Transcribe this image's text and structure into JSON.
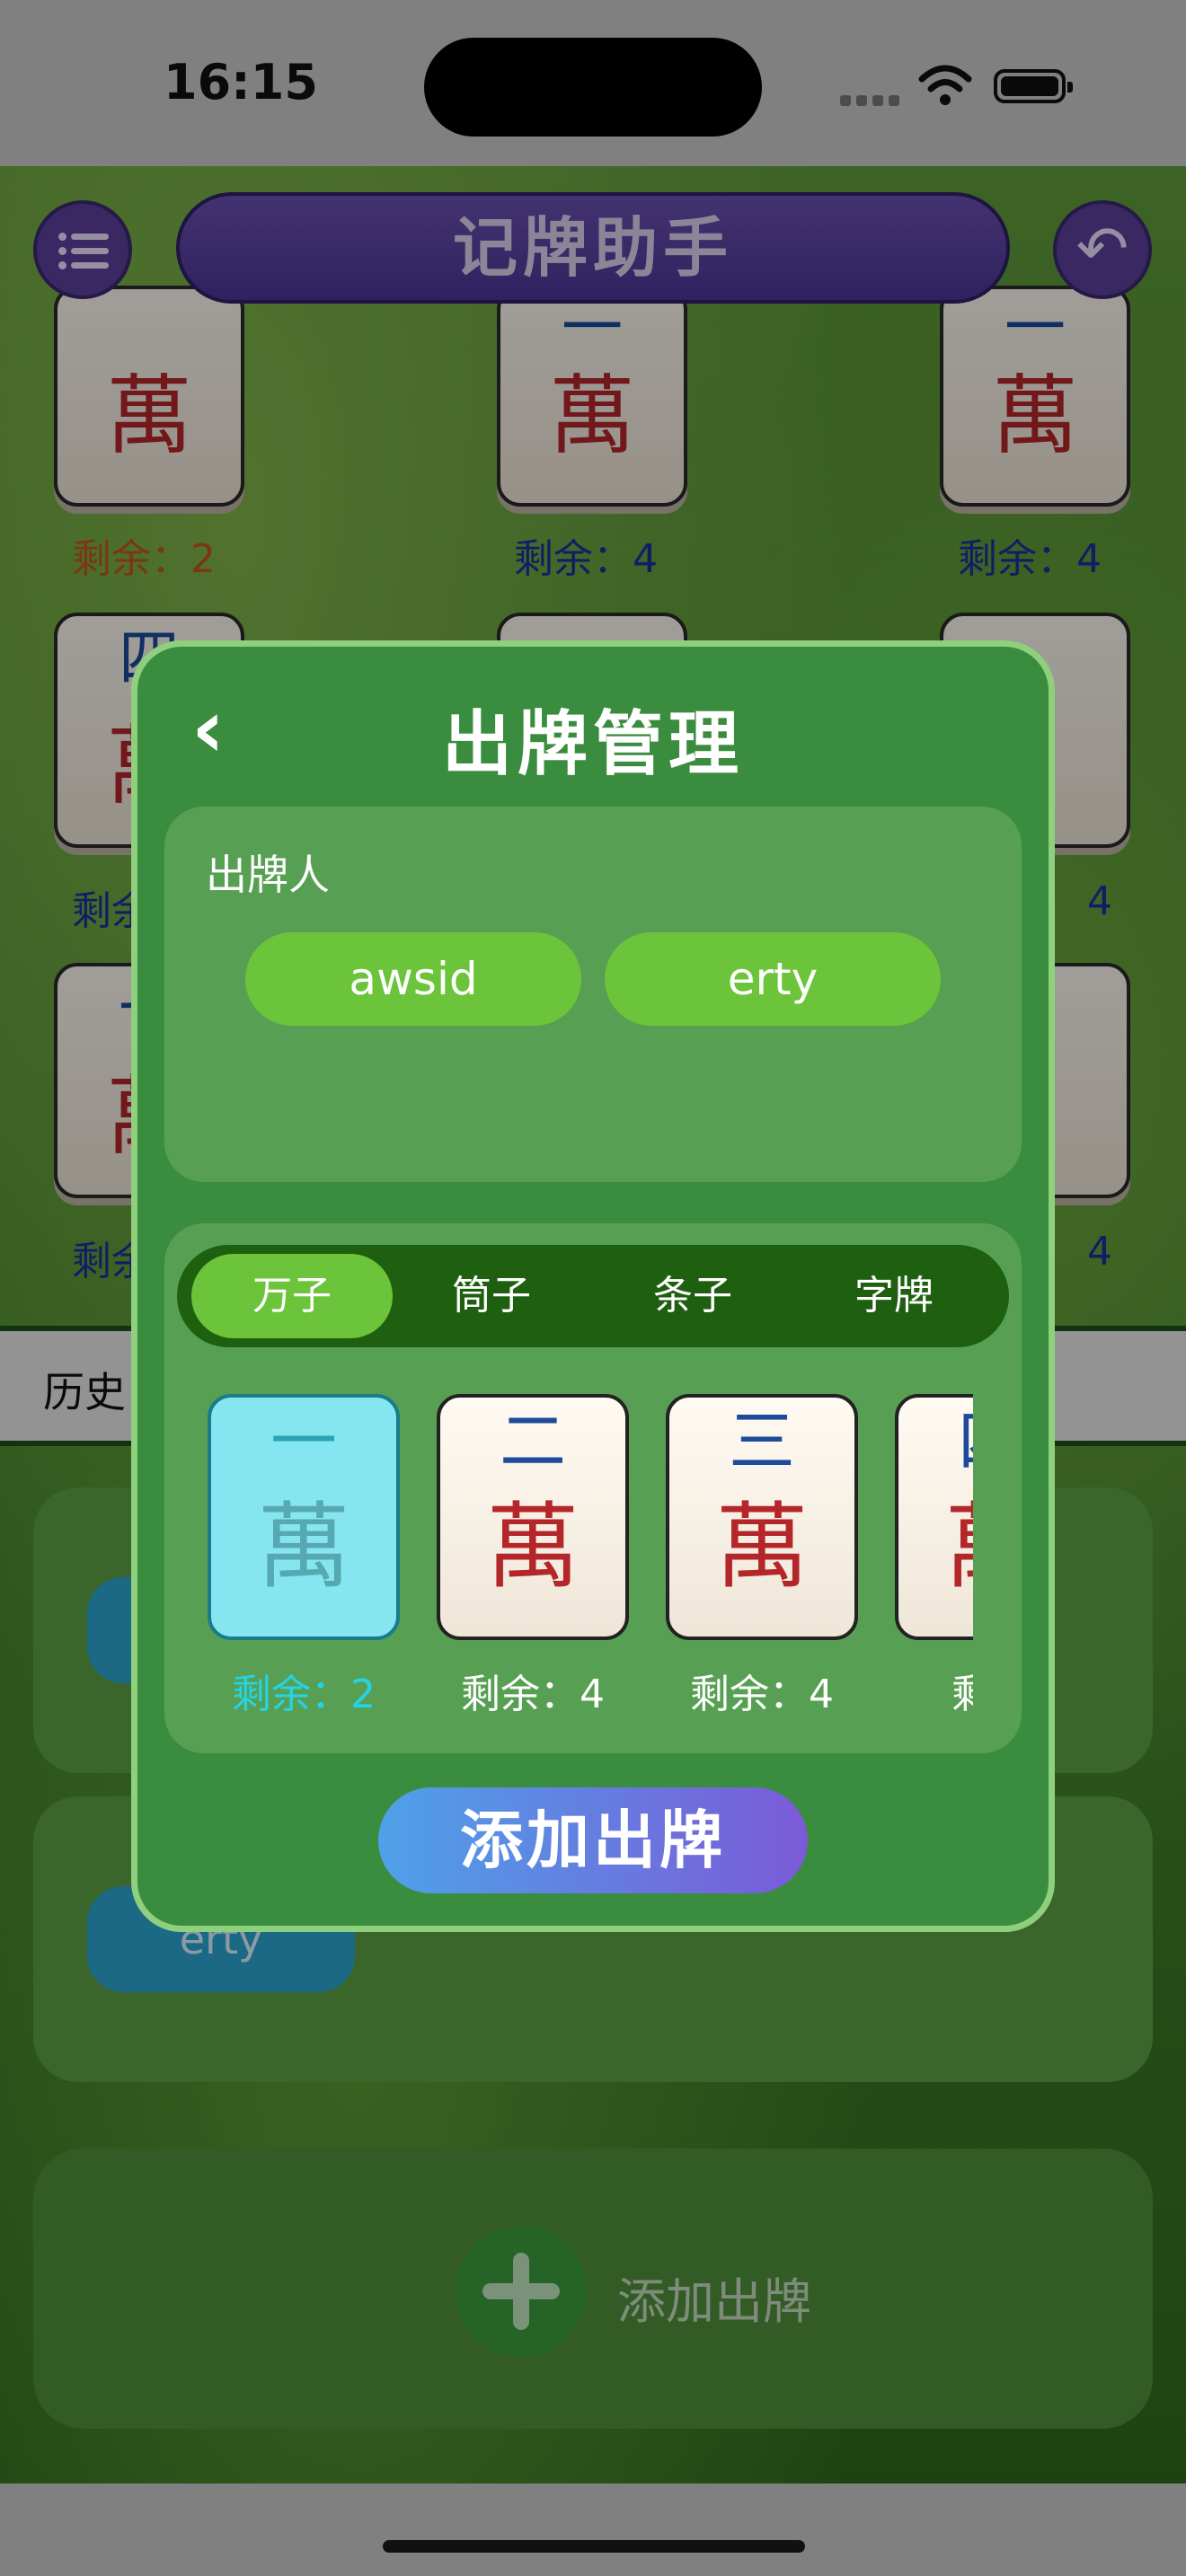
{
  "status_bar": {
    "time": "16:15"
  },
  "header": {
    "title": "记牌助手"
  },
  "background_tiles": {
    "row1": [
      {
        "num": "",
        "wan": "萬",
        "remain": "剩余：2",
        "remain_color": "#c0561a"
      },
      {
        "num": "一",
        "wan": "萬",
        "remain": "剩余：4"
      },
      {
        "num": "一",
        "wan": "萬",
        "remain": "剩余：4"
      }
    ],
    "row2": [
      {
        "num": "四",
        "wan": "萬",
        "remain": "剩余"
      },
      {
        "remain": "4"
      }
    ],
    "row3": [
      {
        "num": "一",
        "wan": "萬",
        "remain": "剩余"
      },
      {
        "remain": "4"
      }
    ]
  },
  "history": {
    "label": "历史",
    "cards": [
      {
        "player": ""
      },
      {
        "player": "erty"
      }
    ],
    "add_label": "添加出牌"
  },
  "modal": {
    "back_glyph": "‹",
    "title": "出牌管理",
    "player_section": {
      "label": "出牌人",
      "players": [
        "awsid",
        "erty"
      ]
    },
    "tabs": [
      "万子",
      "筒子",
      "条子",
      "字牌"
    ],
    "active_tab": "万子",
    "tiles": [
      {
        "num": "一",
        "wan": "萬",
        "remain": "剩余：2",
        "selected": true
      },
      {
        "num": "二",
        "wan": "萬",
        "remain": "剩余：4",
        "selected": false
      },
      {
        "num": "三",
        "wan": "萬",
        "remain": "剩余：4",
        "selected": false
      },
      {
        "num": "四",
        "wan": "萬",
        "remain": "剩余",
        "selected": false
      }
    ],
    "add_button": "添加出牌"
  },
  "colors": {
    "modal_bg": "#3a8d3e",
    "accent_green": "#6cc43b",
    "title_purple": "#4b3596",
    "selected_tile": "#86e6f0"
  }
}
